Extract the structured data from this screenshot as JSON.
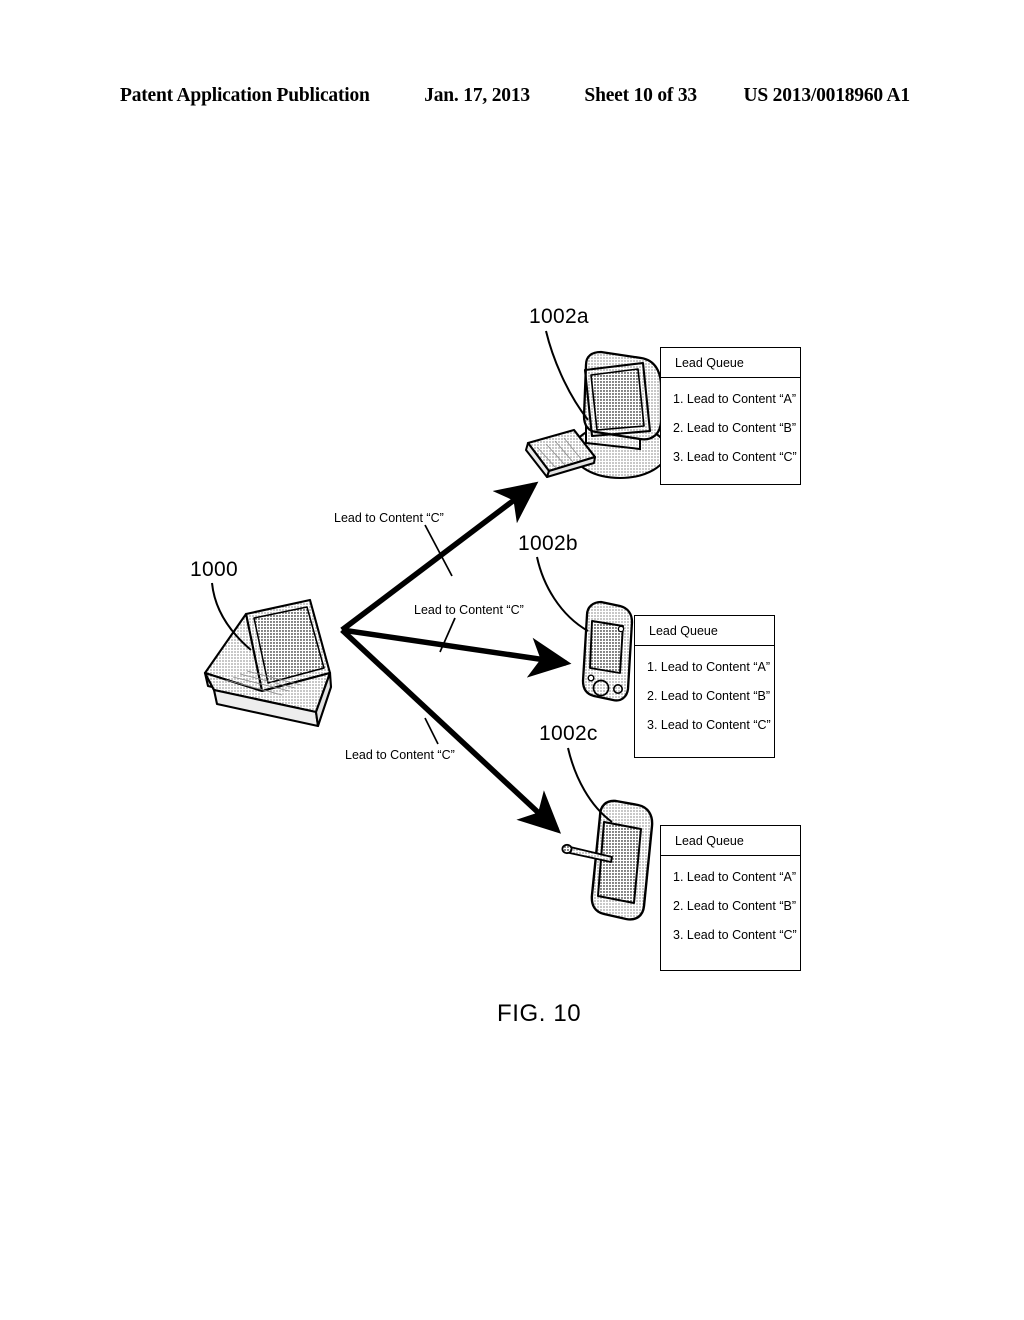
{
  "header": {
    "left": "Patent Application Publication",
    "date": "Jan. 17, 2013",
    "sheet": "Sheet 10 of 33",
    "patent_number": "US 2013/0018960 A1"
  },
  "figure": {
    "caption": "FIG. 10"
  },
  "source_device": {
    "ref": "1000",
    "icon": "laptop-icon"
  },
  "arrows": [
    {
      "name": "arrow-to-desktop",
      "label": "Lead to Content “C”"
    },
    {
      "name": "arrow-to-phone",
      "label": "Lead to Content “C”"
    },
    {
      "name": "arrow-to-tablet",
      "label": "Lead to Content “C”"
    }
  ],
  "targets": [
    {
      "ref": "1002a",
      "icon": "desktop-computer-icon",
      "queue": {
        "title": "Lead Queue",
        "items": [
          "1. Lead to Content “A”",
          "2. Lead to Content “B”",
          "3. Lead to Content “C”"
        ]
      }
    },
    {
      "ref": "1002b",
      "icon": "mobile-phone-icon",
      "queue": {
        "title": "Lead Queue",
        "items": [
          "1. Lead to Content “A”",
          "2. Lead to Content “B”",
          "3. Lead to Content “C”"
        ]
      }
    },
    {
      "ref": "1002c",
      "icon": "tablet-stylus-icon",
      "queue": {
        "title": "Lead Queue",
        "items": [
          "1. Lead to Content “A”",
          "2. Lead to Content “B”",
          "3. Lead to Content “C”"
        ]
      }
    }
  ],
  "colors": {
    "ink": "#000000",
    "paper": "#ffffff",
    "device_fill": "#d8d8d8"
  }
}
